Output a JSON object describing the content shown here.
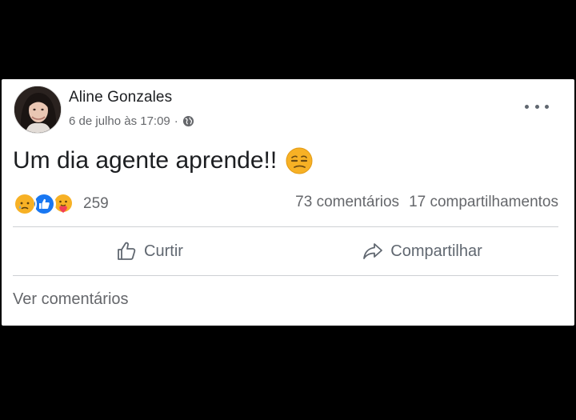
{
  "post": {
    "author": "Aline Gonzales",
    "timestamp": "6 de julho às 17:09",
    "separator": "·",
    "privacy_icon": "globe-icon",
    "text": "Um dia agente aprende!!",
    "emoji": "unamused-face-emoji",
    "more_icon": "more-options-icon"
  },
  "reactions": {
    "icons": [
      "sad-reaction-icon",
      "like-reaction-icon",
      "care-reaction-icon"
    ],
    "count": "259"
  },
  "stats": {
    "comments": "73 comentários",
    "shares": "17 compartilhamentos"
  },
  "actions": {
    "like_label": "Curtir",
    "share_label": "Compartilhar"
  },
  "footer": {
    "view_comments": "Ver comentários"
  },
  "colors": {
    "card_bg": "#ffffff",
    "text_primary": "#1c1e21",
    "text_secondary": "#65676b",
    "like_blue": "#1877f2",
    "reaction_yellow": "#f7b125"
  }
}
